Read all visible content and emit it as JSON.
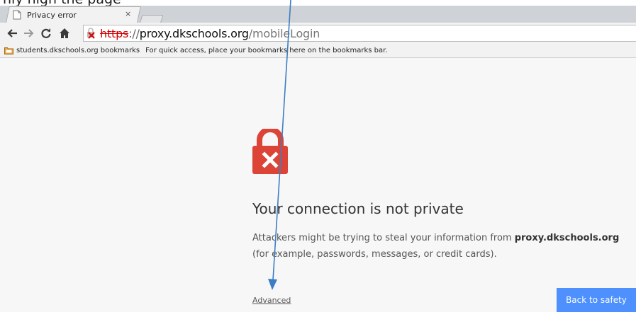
{
  "partial_text": "nly high the page",
  "browser": {
    "tab": {
      "title": "Privacy error",
      "close_glyph": "×"
    },
    "toolbar": {
      "url": {
        "scheme": "https",
        "separator": "://",
        "host": "proxy.dkschools.org",
        "path": "/mobileLogin"
      }
    },
    "bookmarks_bar": {
      "folder_label": "students.dkschools.org bookmarks",
      "hint": "For quick access, place your bookmarks here on the bookmarks bar."
    }
  },
  "interstitial": {
    "heading": "Your connection is not private",
    "message_prefix": "Attackers might be trying to steal your information from ",
    "message_host": "proxy.dkschools.org",
    "message_suffix": " (for example, passwords, messages, or credit cards).",
    "advanced_label": "Advanced",
    "back_button_label": "Back to safety"
  },
  "colors": {
    "error_red": "#db4437",
    "button_blue": "#4d90fe",
    "annotation_arrow": "#3d7dc4"
  },
  "icons": {
    "tab_favicon": "page-icon",
    "back": "back-arrow-icon",
    "forward": "forward-arrow-icon",
    "reload": "reload-icon",
    "home": "home-icon",
    "security_indicator": "broken-lock-icon",
    "bookmark_folder": "folder-icon",
    "hero": "red-padlock-x-icon"
  }
}
